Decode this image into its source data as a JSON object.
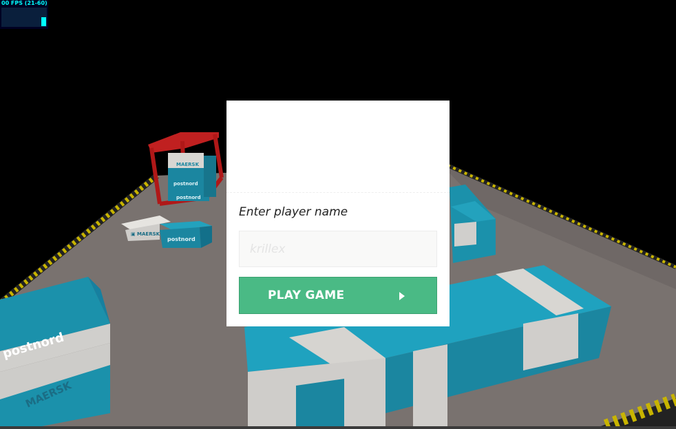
{
  "fps_meter": {
    "text": "00 FPS (21-60)",
    "level": 0.5
  },
  "scene": {
    "container_brands": [
      "postnord",
      "MAERSK"
    ],
    "colors": {
      "floor": "#7e7876",
      "container_blue": "#138aa4",
      "container_white": "#d2d0cd",
      "crane": "#b01818",
      "hazard_yellow": "#c8b400"
    }
  },
  "modal": {
    "label": "Enter player name",
    "input_placeholder": "krillex",
    "input_value": "",
    "play_button_label": "PLAY GAME",
    "play_icon": "play-triangle-icon"
  }
}
